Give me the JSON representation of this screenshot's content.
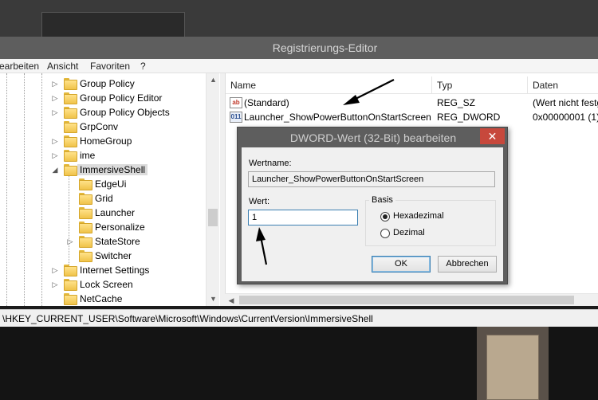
{
  "window": {
    "title": "Registrierungs-Editor"
  },
  "menu": [
    "earbeiten",
    "Ansicht",
    "Favoriten",
    "?"
  ],
  "tree": {
    "items": [
      {
        "label": "Group Policy",
        "level": 0,
        "expander": "▷"
      },
      {
        "label": "Group Policy Editor",
        "level": 0,
        "expander": "▷"
      },
      {
        "label": "Group Policy Objects",
        "level": 0,
        "expander": "▷"
      },
      {
        "label": "GrpConv",
        "level": 0,
        "expander": ""
      },
      {
        "label": "HomeGroup",
        "level": 0,
        "expander": "▷"
      },
      {
        "label": "ime",
        "level": 0,
        "expander": "▷"
      },
      {
        "label": "ImmersiveShell",
        "level": 0,
        "expander": "◢",
        "selected": true
      },
      {
        "label": "EdgeUi",
        "level": 1,
        "expander": ""
      },
      {
        "label": "Grid",
        "level": 1,
        "expander": ""
      },
      {
        "label": "Launcher",
        "level": 1,
        "expander": ""
      },
      {
        "label": "Personalize",
        "level": 1,
        "expander": ""
      },
      {
        "label": "StateStore",
        "level": 1,
        "expander": "▷"
      },
      {
        "label": "Switcher",
        "level": 1,
        "expander": ""
      },
      {
        "label": "Internet Settings",
        "level": 0,
        "expander": "▷"
      },
      {
        "label": "Lock Screen",
        "level": 0,
        "expander": "▷"
      },
      {
        "label": "NetCache",
        "level": 0,
        "expander": ""
      }
    ]
  },
  "list": {
    "columns": [
      "Name",
      "Typ",
      "Daten"
    ],
    "rows": [
      {
        "icon": "ab",
        "kind": "sz",
        "name": "(Standard)",
        "type": "REG_SZ",
        "data": "(Wert nicht festg"
      },
      {
        "icon": "011",
        "kind": "dw",
        "name": "Launcher_ShowPowerButtonOnStartScreen",
        "type": "REG_DWORD",
        "data": "0x00000001 (1)"
      }
    ]
  },
  "statusbar": {
    "path": "\\HKEY_CURRENT_USER\\Software\\Microsoft\\Windows\\CurrentVersion\\ImmersiveShell"
  },
  "dialog": {
    "title": "DWORD-Wert (32-Bit) bearbeiten",
    "close": "✕",
    "name_label": "Wertname:",
    "name_value": "Launcher_ShowPowerButtonOnStartScreen",
    "value_label": "Wert:",
    "value": "1",
    "base_label": "Basis",
    "radio_hex": "Hexadezimal",
    "radio_dec": "Dezimal",
    "base_selected": "Hexadezimal",
    "ok": "OK",
    "cancel": "Abbrechen"
  }
}
